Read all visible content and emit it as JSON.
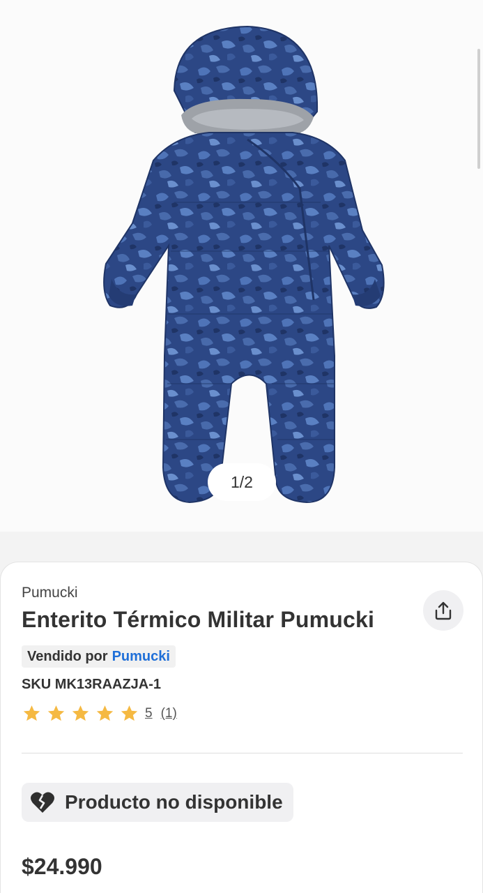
{
  "gallery": {
    "pager": "1/2",
    "image_alt": "Enterito Térmico Militar Pumucki"
  },
  "product": {
    "brand": "Pumucki",
    "title": "Enterito Térmico Militar Pumucki",
    "seller_prefix": "Vendido por",
    "seller_name": "Pumucki",
    "sku": "SKU MK13RAAZJA-1",
    "rating": {
      "stars": 5,
      "value": "5",
      "count": "(1)"
    },
    "availability": "Producto no disponible",
    "price": "$24.990"
  },
  "icons": {
    "share": "share-icon",
    "star": "star-icon",
    "unavailable": "broken-heart-icon"
  },
  "colors": {
    "accent_link": "#1f6fd8",
    "star": "#f5b942",
    "text": "#333333",
    "jumpsuit": "#2d4a86"
  }
}
